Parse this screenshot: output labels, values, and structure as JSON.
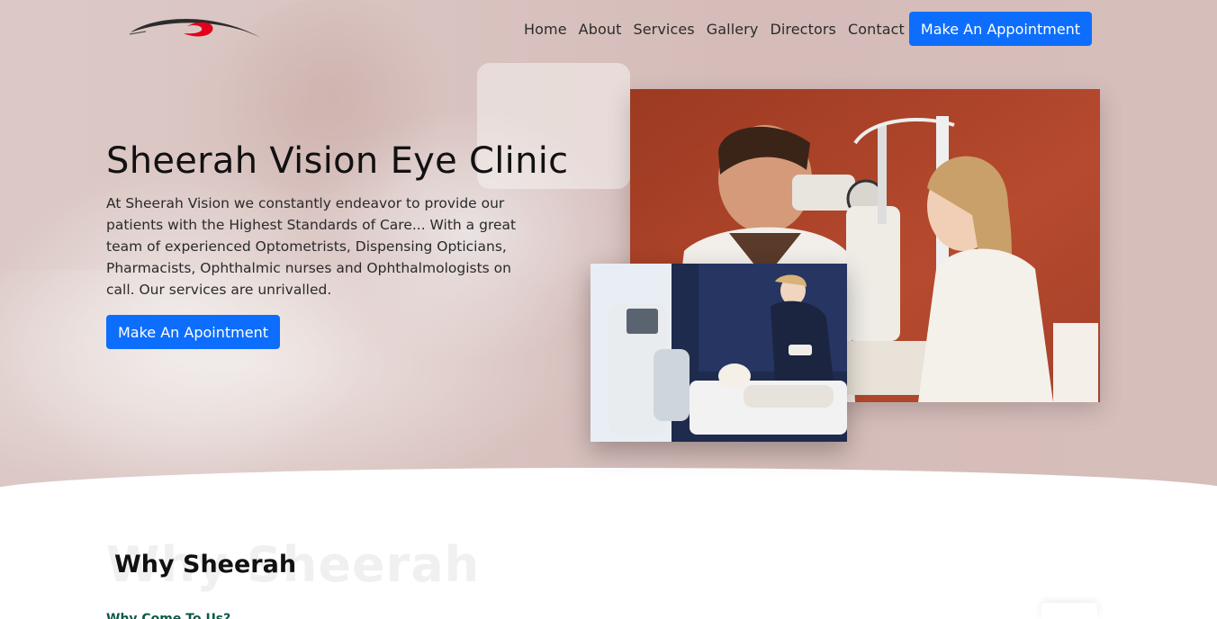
{
  "nav": {
    "links": [
      "Home",
      "About",
      "Services",
      "Gallery",
      "Directors",
      "Contact"
    ],
    "cta_label": "Make An Appointment"
  },
  "hero": {
    "title": "Sheerah Vision Eye Clinic",
    "text": "At Sheerah Vision we constantly endeavor to provide our patients with the Highest Standards of Care... With a great team of experienced Optometrists, Dispensing Opticians, Pharmacists, Ophthalmic nurses and Ophthalmologists on call. Our services are unrivalled.",
    "cta_label": "Make An Apointment"
  },
  "why": {
    "ghost_title": "Why Sheerah",
    "title": "Why Sheerah",
    "subtitle": "Why Come To Us?"
  },
  "colors": {
    "primary": "#0d6efd",
    "logo_red": "#e3001b",
    "logo_dark": "#2c2c2c"
  }
}
